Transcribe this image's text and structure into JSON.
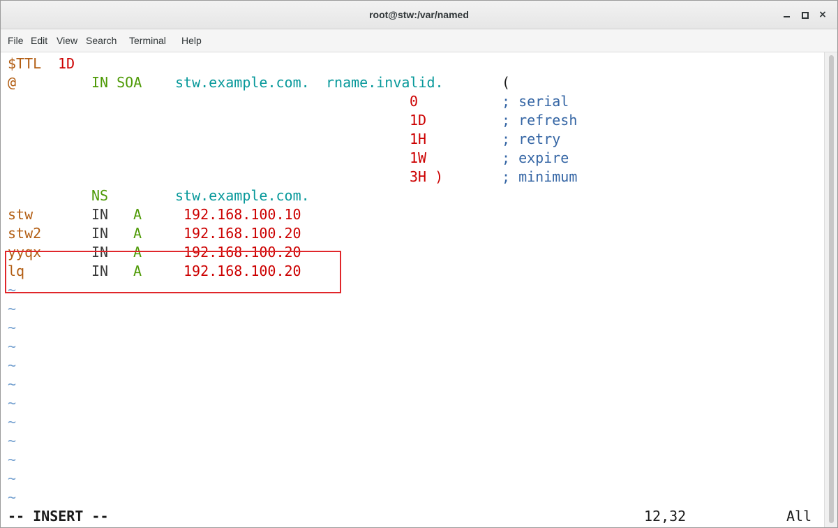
{
  "window": {
    "title": "root@stw:/var/named",
    "minimize_label": "_",
    "close_label": "×"
  },
  "menu": {
    "items": [
      "File",
      "Edit",
      "View",
      "Search",
      "Terminal",
      "Help"
    ]
  },
  "editor": {
    "mode": "vim",
    "lines": [
      {
        "c1": "$TTL",
        "c2": "1D"
      },
      {
        "at": "@",
        "class": "IN SOA",
        "mname": "stw.example.com.",
        "rname": "rname.invalid.",
        "paren": "("
      },
      {
        "value": "0",
        "comment": "; serial"
      },
      {
        "value": "1D",
        "comment": "; refresh"
      },
      {
        "value": "1H",
        "comment": "; retry"
      },
      {
        "value": "1W",
        "comment": "; expire"
      },
      {
        "value": "3H )",
        "comment": "; minimum"
      },
      {
        "name": "",
        "class": "NS",
        "type": "",
        "data": "stw.example.com."
      },
      {
        "name": "stw",
        "class": "IN",
        "type": "A",
        "data": "192.168.100.10"
      },
      {
        "name": "stw2",
        "class": "IN",
        "type": "A",
        "data": "192.168.100.20"
      },
      {
        "name": "yyqx",
        "class": "IN",
        "type": "A",
        "data": "192.168.100.20"
      },
      {
        "name": "lq",
        "class": "IN",
        "type": "A",
        "data": "192.168.100.20"
      }
    ],
    "empty_marker": "~",
    "highlighted_records": [
      "yyqx",
      "lq"
    ]
  },
  "statusline": {
    "mode": "-- INSERT --",
    "position": "12,32",
    "scroll": "All"
  },
  "colors": {
    "owner": "#b25d12",
    "number": "#cc0000",
    "keyword": "#4e9a06",
    "domain": "#06989a",
    "comment": "#3465a4",
    "highlight_border": "#e0262a"
  }
}
